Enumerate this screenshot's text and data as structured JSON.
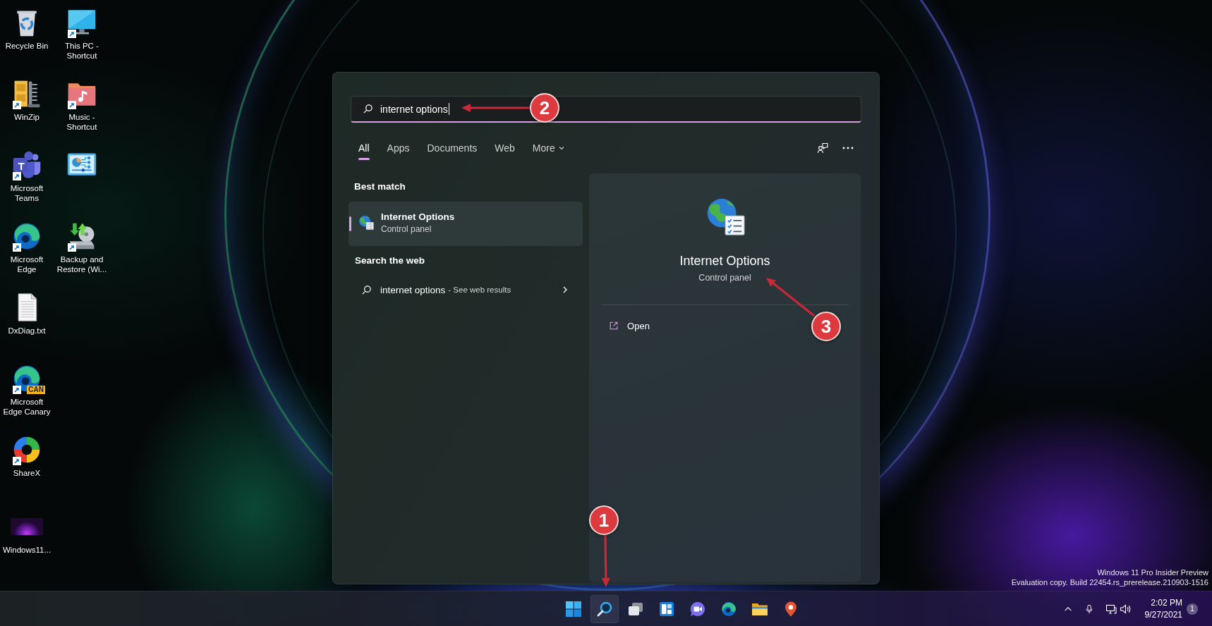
{
  "desktop": {
    "columns": [
      {
        "items": [
          {
            "label": "Recycle Bin",
            "kind": "recycle",
            "shortcut": false
          },
          {
            "label": "WinZip",
            "kind": "archive",
            "shortcut": true
          },
          {
            "label": "Microsoft Teams",
            "kind": "chat",
            "shortcut": true,
            "badge": "T"
          },
          {
            "label": "Microsoft Edge",
            "kind": "browser",
            "shortcut": true
          },
          {
            "label": "DxDiag.txt",
            "kind": "text",
            "shortcut": false
          },
          {
            "label": "Microsoft Edge Canary",
            "kind": "canary",
            "shortcut": true,
            "badge": "CAN"
          },
          {
            "label": "ShareX",
            "kind": "capture",
            "shortcut": true
          },
          {
            "label": "Windows11...",
            "kind": "image",
            "shortcut": false
          }
        ]
      },
      {
        "items": [
          {
            "label": "This PC - Shortcut",
            "kind": "computer",
            "shortcut": true
          },
          {
            "label": "Music - Shortcut",
            "kind": "music",
            "shortcut": true
          },
          {
            "kind": "settings",
            "shortcut": false
          },
          {
            "label": "Backup and Restore (Wi...",
            "kind": "backup",
            "shortcut": true
          }
        ]
      }
    ]
  },
  "search_panel": {
    "search_box": {
      "value": "internet options"
    },
    "tabs": [
      {
        "label": "All",
        "selected": true
      },
      {
        "label": "Apps",
        "selected": false
      },
      {
        "label": "Documents",
        "selected": false
      },
      {
        "label": "Web",
        "selected": false
      },
      {
        "label": "More",
        "selected": false,
        "dropdown": true
      }
    ],
    "best_match": {
      "heading": "Best match",
      "items": [
        {
          "title": "Internet Options",
          "subtitle": "Control panel",
          "selected": true
        }
      ]
    },
    "web": {
      "heading": "Search the web",
      "items": [
        {
          "query": "internet options",
          "suffix": "- See web results"
        }
      ]
    },
    "preview": {
      "title": "Internet Options",
      "subtitle": "Control panel",
      "actions": [
        {
          "label": "Open"
        }
      ]
    }
  },
  "build_info": {
    "lines": [
      "Windows 11 Pro Insider Preview",
      "Evaluation copy. Build 22454.rs_prerelease.210903-1516"
    ]
  },
  "annotations": [
    {
      "label": "1"
    },
    {
      "label": "2"
    },
    {
      "label": "3"
    }
  ],
  "taskbar": {
    "items": [
      {
        "kind": "start",
        "selected": false
      },
      {
        "kind": "search",
        "selected": true
      },
      {
        "kind": "taskview",
        "selected": false
      },
      {
        "kind": "widgets",
        "selected": false
      },
      {
        "kind": "chat",
        "selected": false
      },
      {
        "kind": "browser",
        "selected": false
      },
      {
        "kind": "explorer",
        "selected": false
      },
      {
        "kind": "maps",
        "selected": false
      }
    ],
    "tray": [
      {
        "kind": "chevron"
      },
      {
        "kind": "microphone"
      },
      {
        "kind": "network"
      },
      {
        "kind": "volume"
      }
    ],
    "clock": {
      "time": "2:02 PM",
      "date": "9/27/2021"
    },
    "notifications": {
      "count": "1"
    }
  }
}
